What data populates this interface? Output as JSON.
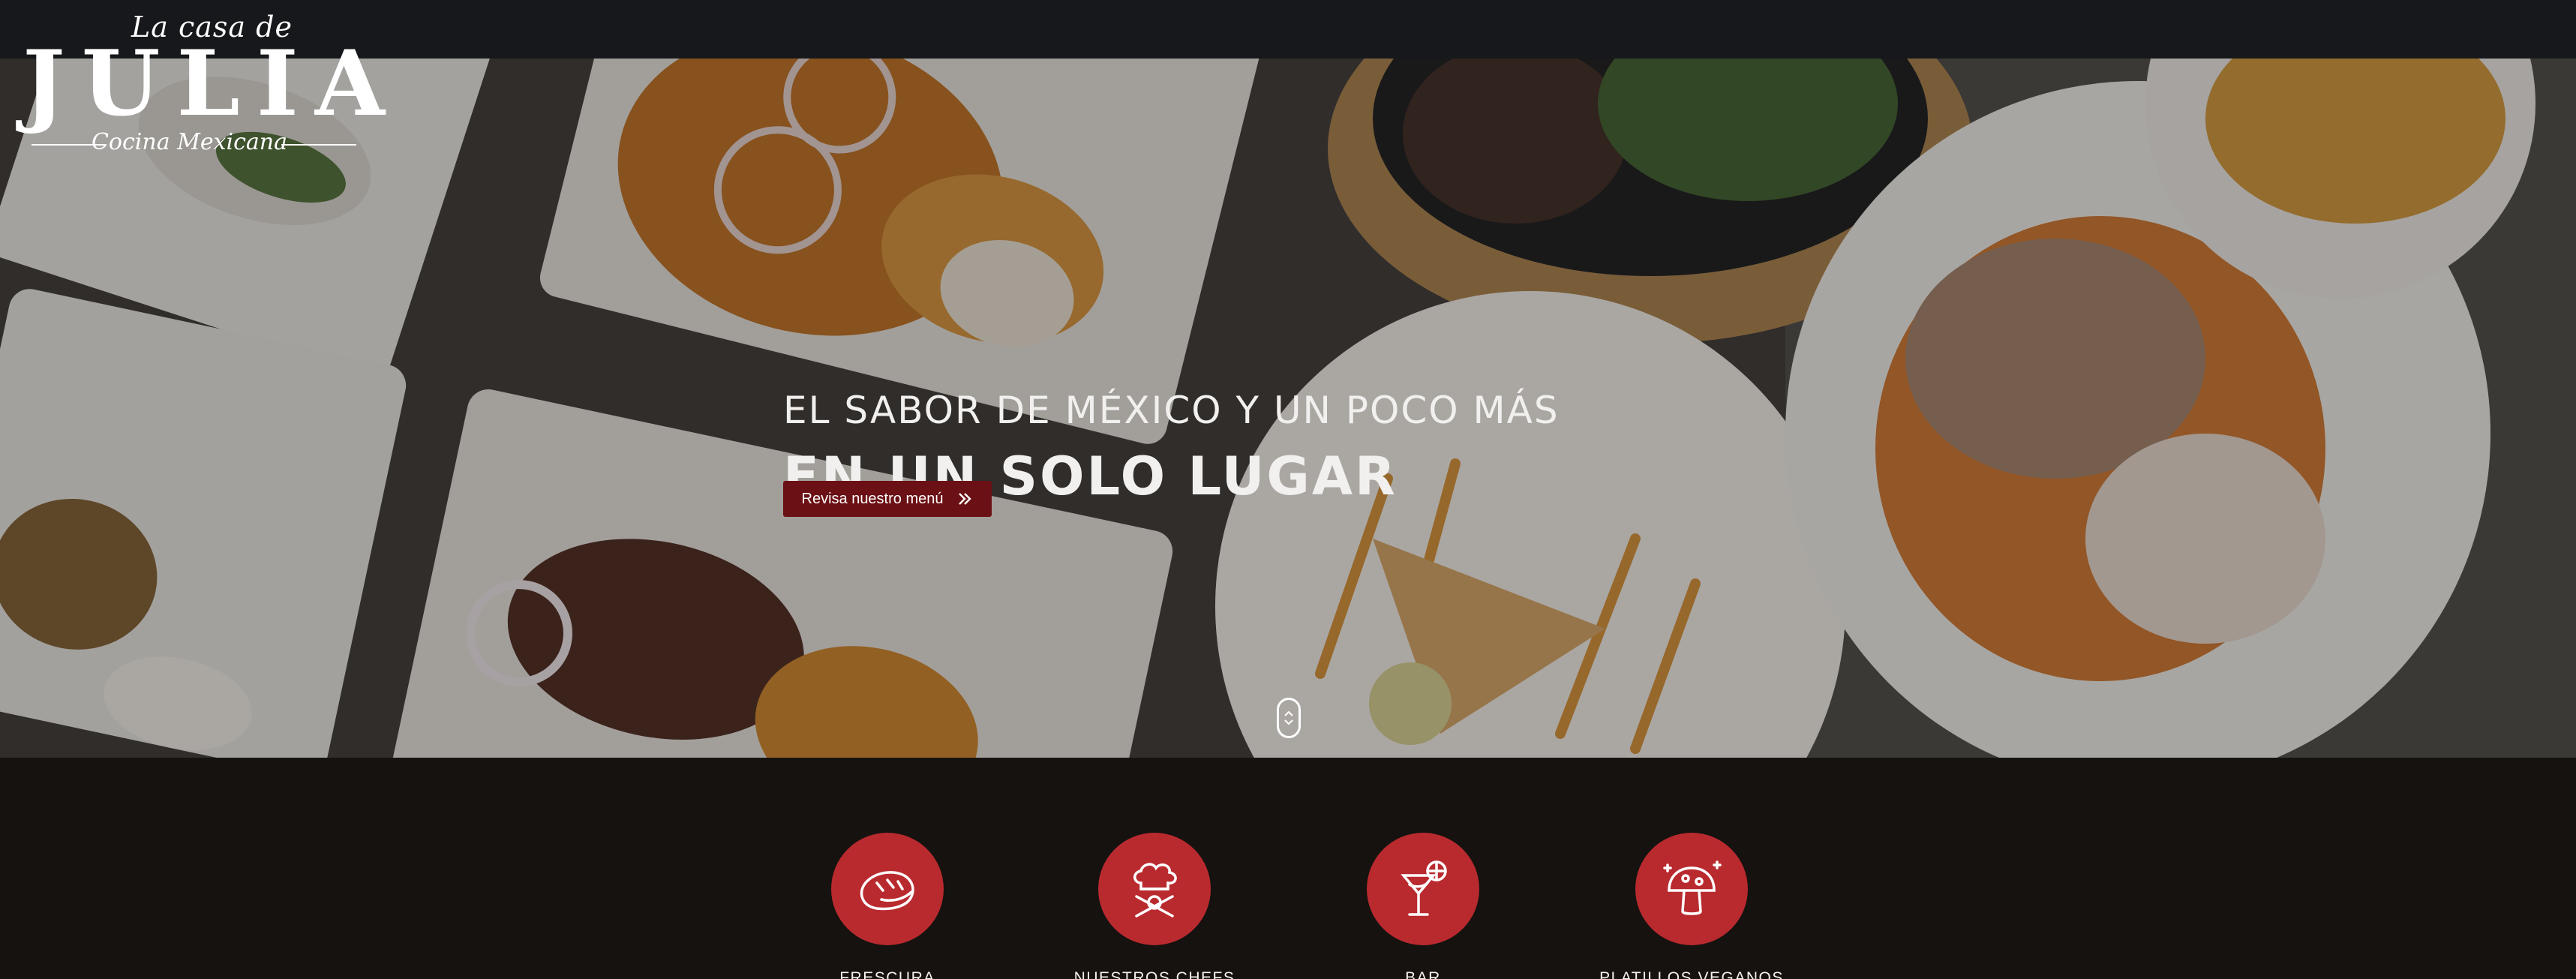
{
  "brand": {
    "prefix": "La casa de",
    "name": "JULIA",
    "tagline": "Cocina Mexicana"
  },
  "hero": {
    "line1": "EL SABOR DE MÉXICO Y UN POCO MÁS",
    "line2": "EN UN SOLO LUGAR",
    "cta_label": "Revisa nuestro menú",
    "cta_icon": "double-chevron-right-icon",
    "scroll_icon": "scroll-mouse-icon"
  },
  "features": [
    {
      "label": "FRESCURA",
      "icon": "bread-icon"
    },
    {
      "label": "NUESTROS CHEFS",
      "icon": "chef-hat-icon"
    },
    {
      "label": "BAR",
      "icon": "cocktail-icon"
    },
    {
      "label": "PLATILLOS VEGANOS",
      "icon": "mushroom-icon"
    }
  ],
  "colors": {
    "accent": "#b92a2f",
    "button": "#6b1014",
    "topbar": "#17181b",
    "footer_bg": "#15120f"
  }
}
